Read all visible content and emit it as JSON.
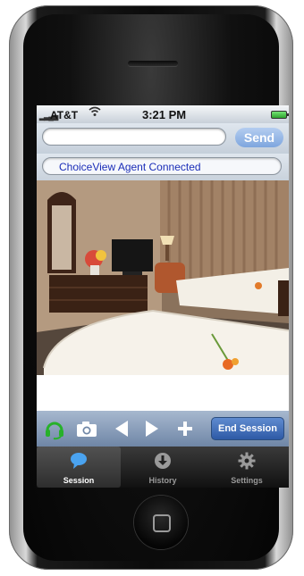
{
  "statusbar": {
    "carrier": "AT&T",
    "time": "3:21 PM"
  },
  "topbar": {
    "input_value": "",
    "send_label": "Send"
  },
  "connection_status": "ChoiceView Agent Connected",
  "toolbar": {
    "icons": [
      "headset-icon",
      "camera-icon",
      "back-arrow-icon",
      "forward-arrow-icon",
      "plus-icon"
    ],
    "end_session_label": "End Session"
  },
  "tabs": [
    {
      "label": "Session",
      "icon": "chat-bubble-icon",
      "selected": true
    },
    {
      "label": "History",
      "icon": "download-icon",
      "selected": false
    },
    {
      "label": "Settings",
      "icon": "gear-icon",
      "selected": false
    }
  ],
  "colors": {
    "status_text": "#1a2db8",
    "send_button": "#7ea6de",
    "end_session_button": "#2e5aa6",
    "toolbar": "#8aa0be",
    "headset_icon": "#27b12a"
  }
}
